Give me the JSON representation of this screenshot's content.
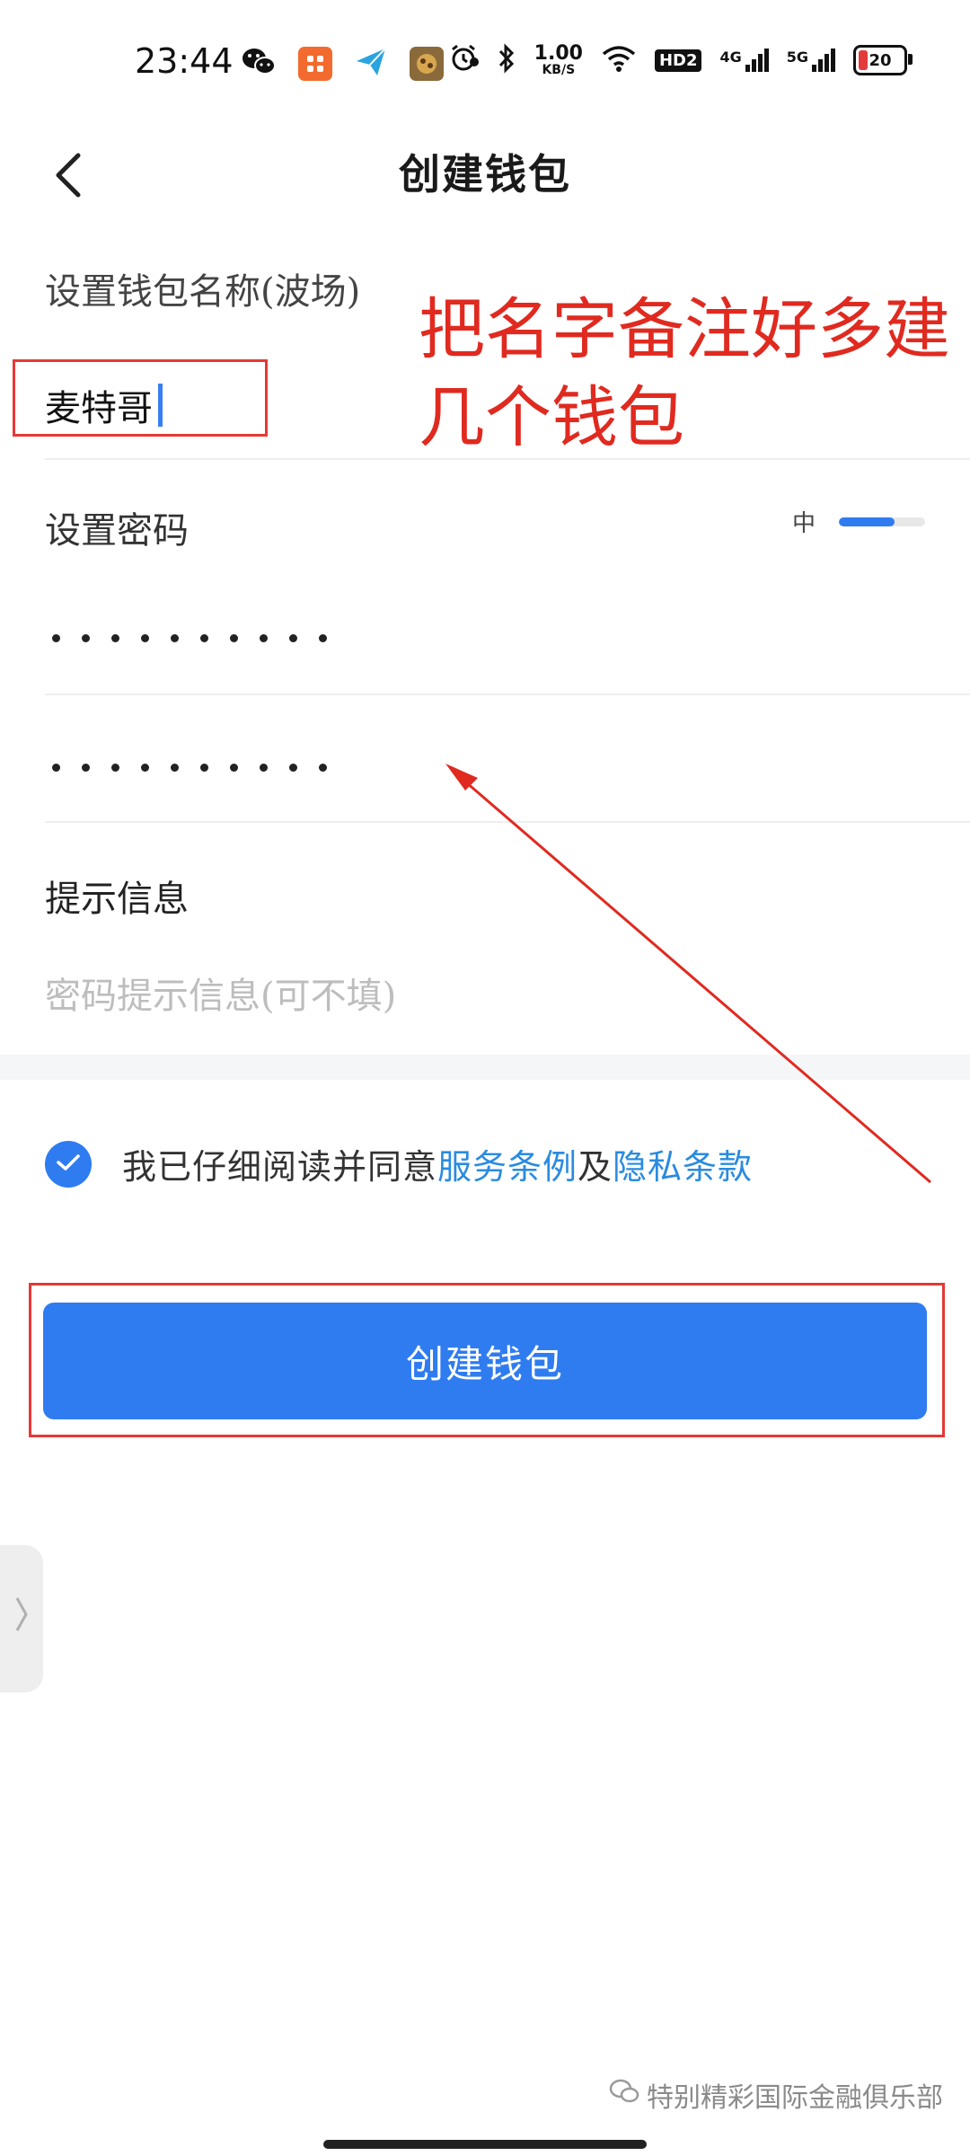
{
  "status_bar": {
    "time": "23:44",
    "net_speed_value": "1.00",
    "net_speed_unit": "KB/S",
    "hd_label": "HD2",
    "net1_label": "4G",
    "net2_label": "5G",
    "battery_level": "20",
    "battery_color": "#e33b3b"
  },
  "header": {
    "title": "创建钱包"
  },
  "form": {
    "wallet_name_label": "设置钱包名称(波场)",
    "wallet_name_value": "麦特哥",
    "password_label": "设置密码",
    "password_strength_text": "中",
    "password_strength_level": 0.65,
    "hint_label": "提示信息",
    "hint_placeholder": "密码提示信息(可不填)"
  },
  "annotation": {
    "text": "把名字备注好多建几个钱包",
    "color": "#e02a20"
  },
  "agreement": {
    "text_prefix": "我已仔细阅读并同意",
    "terms_link": "服务条例",
    "conjunction": "及",
    "privacy_link": "隐私条款"
  },
  "primary_button": {
    "label": "创建钱包",
    "color": "#2f7cf0"
  },
  "watermark": {
    "text": "特别精彩国际金融俱乐部"
  },
  "icons": {
    "back": "chevron-left-icon",
    "check": "check-icon",
    "side_handle": "chevron-right-icon"
  }
}
